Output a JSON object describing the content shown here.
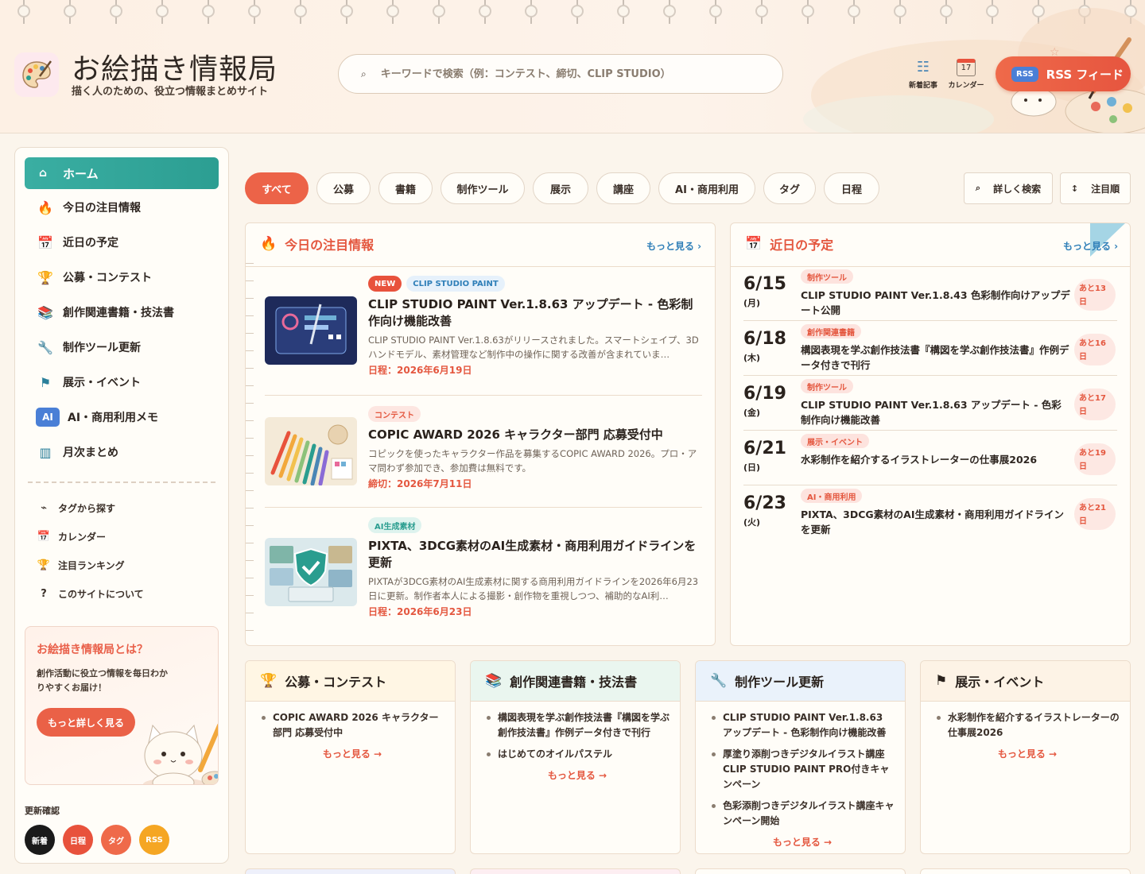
{
  "header": {
    "site_title": "お絵描き情報局",
    "site_subtitle": "描く人のための、役立つ情報まとめサイト",
    "search_placeholder": "キーワードで検索（例：コンテスト、締切、CLIP STUDIO）",
    "buttons": [
      {
        "icon": "list-icon",
        "label": "新着記事"
      },
      {
        "icon": "calendar-icon",
        "label": "カレンダー"
      }
    ],
    "rss_badge": "RSS",
    "rss_label": "RSS フィード",
    "calendar_icon_number": "17"
  },
  "sidebar": {
    "home": "ホーム",
    "items": [
      {
        "icon": "fire-icon",
        "label": "今日の注目情報"
      },
      {
        "icon": "calendar-icon",
        "label": "近日の予定"
      },
      {
        "icon": "trophy-icon",
        "label": "公募・コンテスト"
      },
      {
        "icon": "books-icon",
        "label": "創作関連書籍・技法書"
      },
      {
        "icon": "wrench-icon",
        "label": "制作ツール更新"
      },
      {
        "icon": "flag-icon",
        "label": "展示・イベント"
      },
      {
        "icon": "ai-icon",
        "label": "AI・商用利用メモ"
      },
      {
        "icon": "archive-icon",
        "label": "月次まとめ"
      }
    ],
    "ai_icon_text": "AI",
    "sub_items": [
      {
        "icon": "tag-icon",
        "label": "タグから探す"
      },
      {
        "icon": "calendar-icon",
        "label": "カレンダー"
      },
      {
        "icon": "trophy-icon",
        "label": "注目ランキング"
      },
      {
        "icon": "question-icon",
        "label": "このサイトについて"
      }
    ],
    "about": {
      "title": "お絵描き情報局とは？",
      "text": "創作活動に役立つ情報を毎日わかりやすくお届け！",
      "button": "もっと詳しく見る"
    },
    "update_label": "更新確認",
    "update_circles": [
      {
        "label": "新着",
        "color": "#1a1a1a"
      },
      {
        "label": "日程",
        "color": "#e8523c"
      },
      {
        "label": "タグ",
        "color": "#ef6a4a"
      },
      {
        "label": "RSS",
        "color": "#f5a623"
      }
    ]
  },
  "filters": {
    "chips": [
      "すべて",
      "公募",
      "書籍",
      "制作ツール",
      "展示",
      "講座",
      "AI・商用利用",
      "タグ",
      "日程"
    ],
    "active_index": 0,
    "detail_search": "詳しく検索",
    "sort": "注目順"
  },
  "today": {
    "title": "今日の注目情報",
    "more": "もっと見る ›",
    "articles": [
      {
        "badges": [
          {
            "text": "NEW",
            "kind": "new"
          },
          {
            "text": "CLIP STUDIO PAINT",
            "kind": "csp"
          }
        ],
        "title": "CLIP STUDIO PAINT Ver.1.8.63 アップデート - 色彩制作向け機能改善",
        "desc": "CLIP STUDIO PAINT Ver.1.8.63がリリースされました。スマートシェイプ、3Dハンドモデル、素材管理など制作中の操作に関する改善が含まれていま…",
        "date": "日程：2026年6月19日"
      },
      {
        "badges": [
          {
            "text": "コンテスト",
            "kind": "con"
          }
        ],
        "title": "COPIC AWARD 2026 キャラクター部門 応募受付中",
        "desc": "コピックを使ったキャラクター作品を募集するCOPIC AWARD 2026。プロ・アマ問わず参加でき、参加費は無料です。",
        "date": "締切：2026年7月11日"
      },
      {
        "badges": [
          {
            "text": "AI生成素材",
            "kind": "ai"
          }
        ],
        "title": "PIXTA、3DCG素材のAI生成素材・商用利用ガイドラインを更新",
        "desc": "PIXTAが3DCG素材のAI生成素材に関する商用利用ガイドラインを2026年6月23日に更新。制作者本人による撮影・創作物を重視しつつ、補助的なAI利…",
        "date": "日程：2026年6月23日"
      }
    ]
  },
  "upcoming": {
    "title": "近日の予定",
    "more": "もっと見る ›",
    "events": [
      {
        "date": "6/15",
        "dow": "(月)",
        "tag": "制作ツール",
        "title": "CLIP STUDIO PAINT Ver.1.8.43 色彩制作向けアップデート公開",
        "left": "あと13日"
      },
      {
        "date": "6/18",
        "dow": "(木)",
        "tag": "創作関連書籍",
        "title": "構図表現を学ぶ創作技法書『構図を学ぶ創作技法書』作例データ付きで刊行",
        "left": "あと16日"
      },
      {
        "date": "6/19",
        "dow": "(金)",
        "tag": "制作ツール",
        "title": "CLIP STUDIO PAINT Ver.1.8.63 アップデート - 色彩制作向け機能改善",
        "left": "あと17日"
      },
      {
        "date": "6/21",
        "dow": "(日)",
        "tag": "展示・イベント",
        "title": "水彩制作を紹介するイラストレーターの仕事展2026",
        "left": "あと19日"
      },
      {
        "date": "6/23",
        "dow": "(火)",
        "tag": "AI・商用利用",
        "title": "PIXTA、3DCG素材のAI生成素材・商用利用ガイドラインを更新",
        "left": "あと21日"
      }
    ]
  },
  "categories": [
    {
      "icon": "trophy-icon",
      "title": "公募・コンテスト",
      "bg": "#fff6e4",
      "items": [
        "COPIC AWARD 2026 キャラクター部門 応募受付中"
      ],
      "more": "もっと見る →"
    },
    {
      "icon": "books-icon",
      "title": "創作関連書籍・技法書",
      "bg": "#eaf6ef",
      "items": [
        "構図表現を学ぶ創作技法書『構図を学ぶ創作技法書』作例データ付きで刊行",
        "はじめてのオイルパステル"
      ],
      "more": "もっと見る →"
    },
    {
      "icon": "wrench-icon",
      "title": "制作ツール更新",
      "bg": "#eaf2fb",
      "items": [
        "CLIP STUDIO PAINT Ver.1.8.63 アップデート - 色彩制作向け機能改善",
        "厚塗り添削つきデジタルイラスト講座CLIP STUDIO PAINT PRO付きキャンペーン",
        "色彩添削つきデジタルイラスト講座キャンペーン開始"
      ],
      "more": "もっと見る →"
    },
    {
      "icon": "flag-icon",
      "title": "展示・イベント",
      "bg": "#fdf3e6",
      "items": [
        "水彩制作を紹介するイラストレーターの仕事展2026"
      ],
      "more": "もっと見る →"
    }
  ]
}
